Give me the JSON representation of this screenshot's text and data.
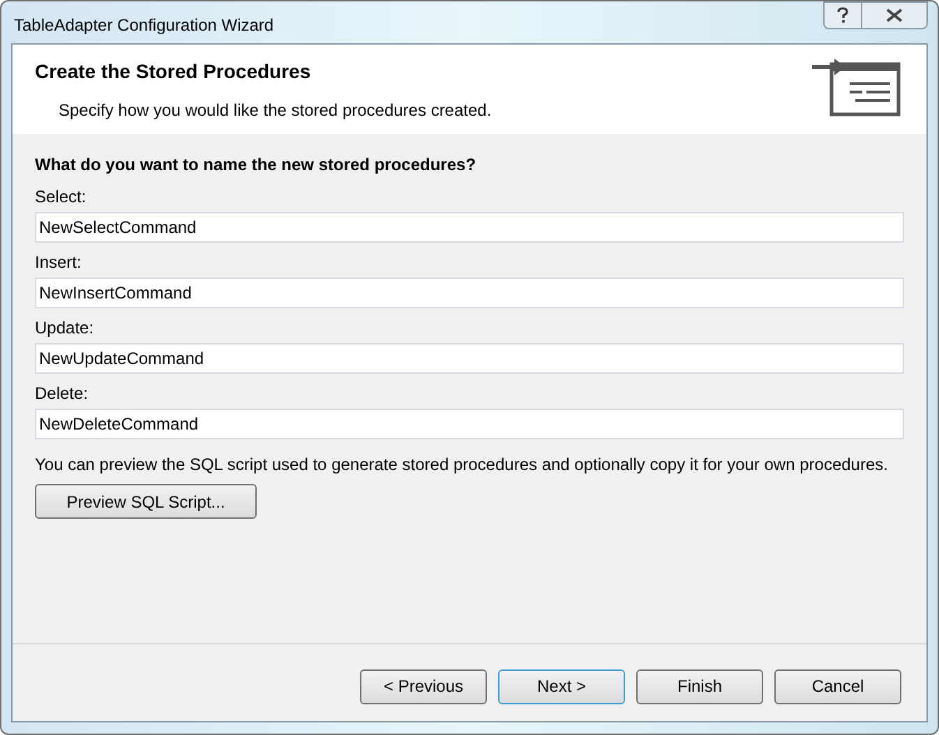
{
  "window": {
    "title": "TableAdapter Configuration Wizard"
  },
  "header": {
    "title": "Create the Stored Procedures",
    "subtitle": "Specify how you would like the stored procedures created."
  },
  "question": "What do you want to name the new stored procedures?",
  "fields": [
    {
      "label": "Select:",
      "value": "NewSelectCommand"
    },
    {
      "label": "Insert:",
      "value": "NewInsertCommand"
    },
    {
      "label": "Update:",
      "value": "NewUpdateCommand"
    },
    {
      "label": "Delete:",
      "value": "NewDeleteCommand"
    }
  ],
  "note": "You can preview the SQL script used to generate stored procedures and optionally copy it for your own procedures.",
  "preview_button": "Preview SQL Script...",
  "buttons": [
    {
      "label": "< Previous",
      "default": false
    },
    {
      "label": "Next >",
      "default": true
    },
    {
      "label": "Finish",
      "default": false
    },
    {
      "label": "Cancel",
      "default": false
    }
  ]
}
